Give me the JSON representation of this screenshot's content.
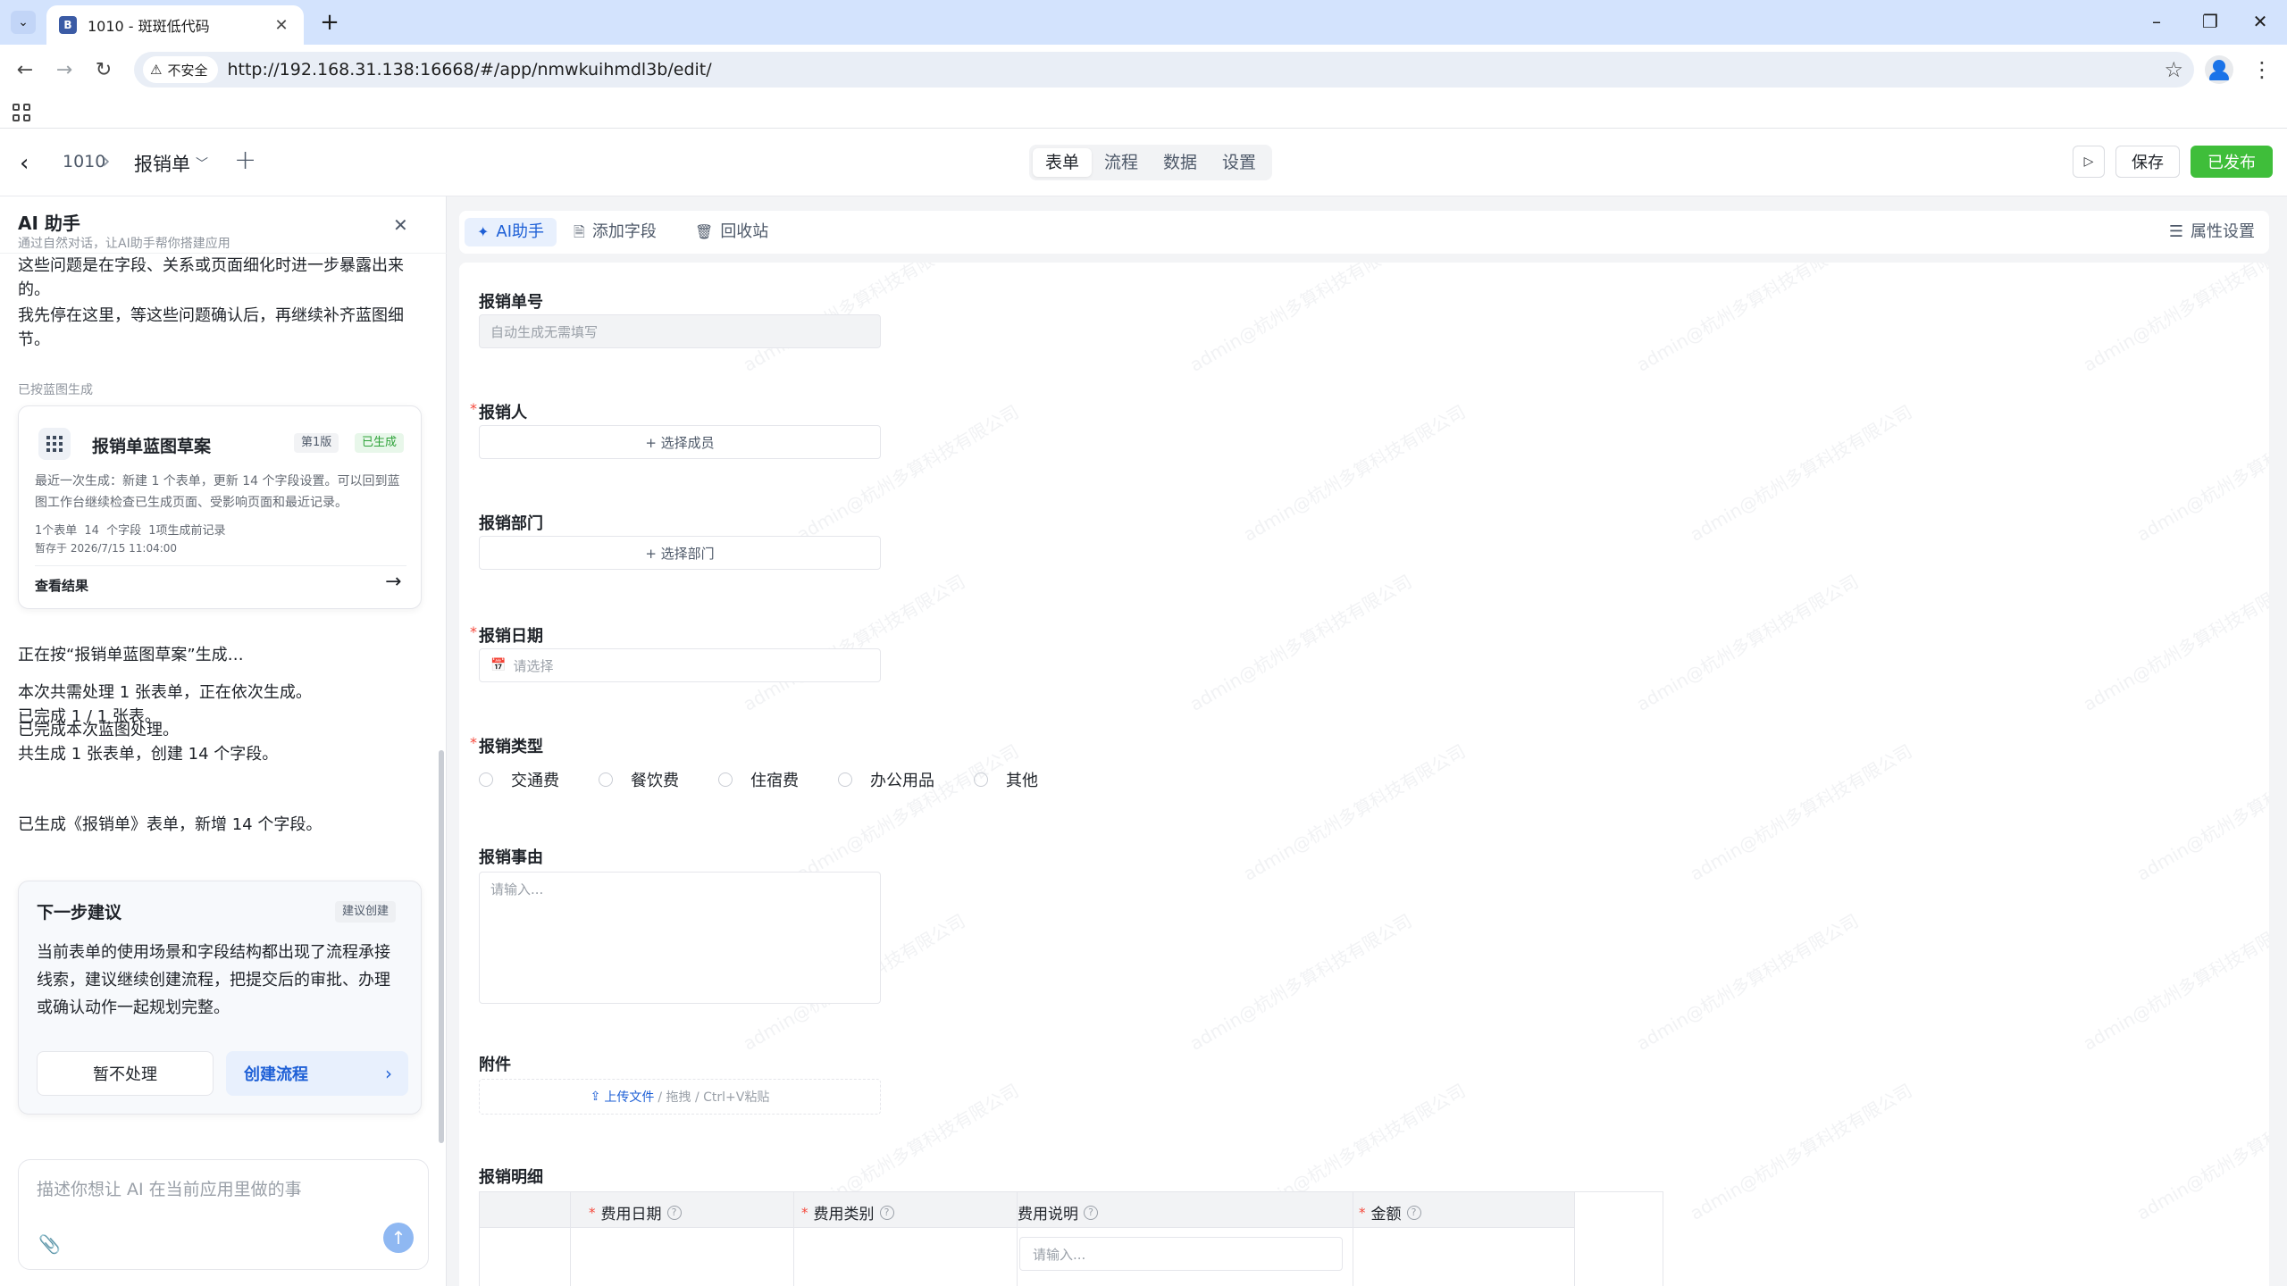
{
  "browser": {
    "tab_title": "1010 - 斑斑低代码",
    "tab_favicon_letter": "B",
    "new_tab_symbol": "+",
    "security_label": "不安全",
    "url": "http://192.168.31.138:16668/#/app/nmwkuihmdl3b/edit/"
  },
  "app_header": {
    "app_name": "1010",
    "form_name": "报销单",
    "tabs": [
      {
        "label": "表单",
        "active": true
      },
      {
        "label": "流程",
        "active": false
      },
      {
        "label": "数据",
        "active": false
      },
      {
        "label": "设置",
        "active": false
      }
    ],
    "save_label": "保存",
    "publish_label": "已发布",
    "publish_color": "#3fbe3a"
  },
  "ai_panel": {
    "title": "AI 助手",
    "subtitle": "通过自然对话，让AI助手帮你搭建应用",
    "messages_top": [
      "这些问题是在字段、关系或页面细化时进一步暴露出来的。",
      "我先停在这里，等这些问题确认后，再继续补齐蓝图细节。"
    ],
    "blueprint_section_label": "已按蓝图生成",
    "blueprint_card": {
      "title": "报销单蓝图草案",
      "version": "第1版",
      "status": "已生成",
      "description": "最近一次生成：新建 1 个表单，更新 14 个字段设置。可以回到蓝图工作台继续检查已生成页面、受影响页面和最近记录。",
      "stats": "1个表单  14 个字段  1项生成前记录",
      "saved_at": "暂存于 2026/7/15 11:04:00",
      "link_label": "查看结果"
    },
    "messages_mid": [
      "正在按“报销单蓝图草案”生成…",
      "本次共需处理 1 张表单，正在依次生成。\n已完成 1 / 1 张表。",
      "已完成本次蓝图处理。\n共生成 1 张表单，创建 14 个字段。",
      "已生成《报销单》表单，新增 14 个字段。"
    ],
    "next_card": {
      "title": "下一步建议",
      "tag": "建议创建",
      "body": "当前表单的使用场景和字段结构都出现了流程承接线索，建议继续创建流程，把提交后的审批、办理或确认动作一起规划完整。",
      "skip_label": "暂不处理",
      "create_label": "创建流程"
    },
    "composer_placeholder": "描述你想让 AI 在当前应用里做的事"
  },
  "canvas_toolbar": {
    "ai_label": "AI助手",
    "add_field_label": "添加字段",
    "recycle_label": "回收站",
    "props_label": "属性设置"
  },
  "form": {
    "watermark": "admin@杭州多算科技有限公司",
    "fields": {
      "no_label": "报销单号",
      "no_placeholder": "自动生成无需填写",
      "person_label": "报销人",
      "person_button": "+ 选择成员",
      "dept_label": "报销部门",
      "dept_button": "+ 选择部门",
      "date_label": "报销日期",
      "date_placeholder": "请选择",
      "type_label": "报销类型",
      "type_options": [
        "交通费",
        "餐饮费",
        "住宿费",
        "办公用品",
        "其他"
      ],
      "reason_label": "报销事由",
      "reason_placeholder": "请输入...",
      "attach_label": "附件",
      "attach_link": "上传文件",
      "attach_hint": " / 拖拽 / Ctrl+V粘贴",
      "detail_label": "报销明细"
    },
    "detail_columns": [
      {
        "label": "费用日期",
        "required": true
      },
      {
        "label": "费用类别",
        "required": true
      },
      {
        "label": "费用说明",
        "required": false
      },
      {
        "label": "金额",
        "required": true
      }
    ],
    "detail_input_placeholder": "请输入..."
  }
}
